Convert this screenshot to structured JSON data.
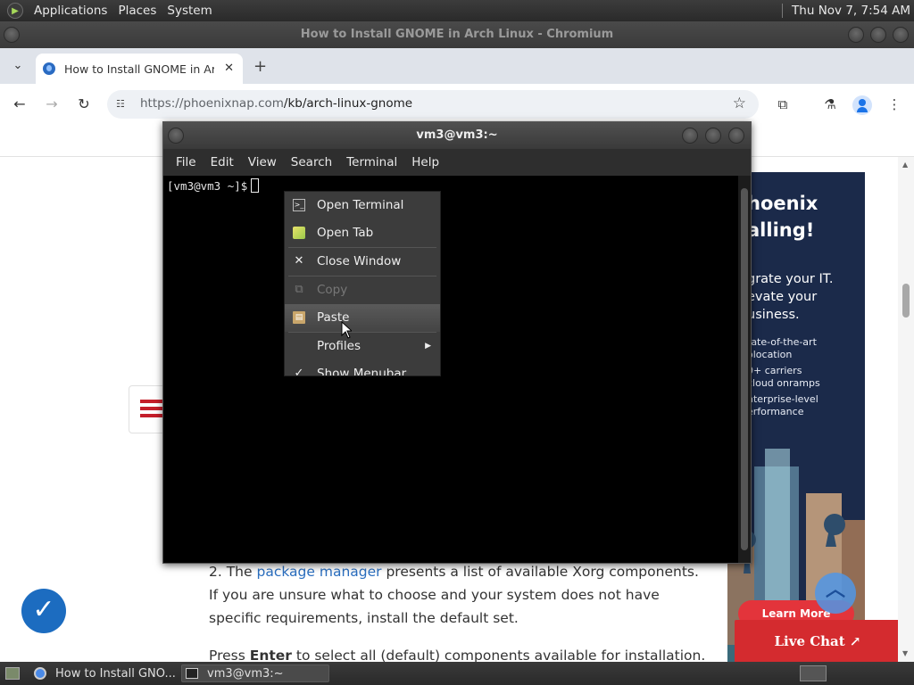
{
  "top_panel": {
    "menus": [
      "Applications",
      "Places",
      "System"
    ],
    "clock": "Thu Nov 7, 7:54 AM"
  },
  "browser": {
    "window_title": "How to Install GNOME in Arch Linux - Chromium",
    "tab": {
      "title": "How to Install GNOME in Arch Linux"
    },
    "url": {
      "host": "https://phoenixnap.com",
      "path": "/kb/arch-linux-gnome"
    }
  },
  "terminal": {
    "title": "vm3@vm3:~",
    "menus": [
      "File",
      "Edit",
      "View",
      "Search",
      "Terminal",
      "Help"
    ],
    "prompt": "[vm3@vm3 ~]$"
  },
  "context_menu": {
    "items": [
      {
        "label": "Open Terminal",
        "icon": "terminal-icon"
      },
      {
        "label": "Open Tab",
        "icon": "tab-icon"
      },
      {
        "label": "Close Window",
        "icon": "close-icon"
      },
      {
        "label": "Copy",
        "icon": "copy-icon",
        "disabled": true
      },
      {
        "label": "Paste",
        "icon": "paste-icon",
        "hovered": true
      },
      {
        "label": "Profiles",
        "icon": "",
        "submenu": true
      },
      {
        "label": "Show Menubar",
        "icon": "check-icon"
      }
    ]
  },
  "page": {
    "para1_prefix": "2. The ",
    "para1_link": "package manager",
    "para1_suffix": " presents a list of available Xorg components. If you are unsure what to choose and your system does not have specific requirements, install the default set.",
    "para2_prefix": "Press ",
    "para2_bold": "Enter",
    "para2_suffix": " to select all (default) components available for installation."
  },
  "ad": {
    "headline": [
      "hoenix",
      "alling!"
    ],
    "subhead": [
      "grate your IT.",
      "evate your",
      "usiness."
    ],
    "bullets": [
      "tate-of-the-art",
      "olocation",
      "0+ carriers",
      "cloud onramps",
      "nterprise-level",
      "erformance"
    ],
    "cta": "Learn More"
  },
  "live_chat": {
    "label": "Live Chat ↗"
  },
  "taskbar": {
    "tasks": [
      "How to Install GNO...",
      "vm3@vm3:~"
    ]
  },
  "colors": {
    "accent_red": "#d42b2f",
    "link_blue": "#2a6ebf"
  }
}
